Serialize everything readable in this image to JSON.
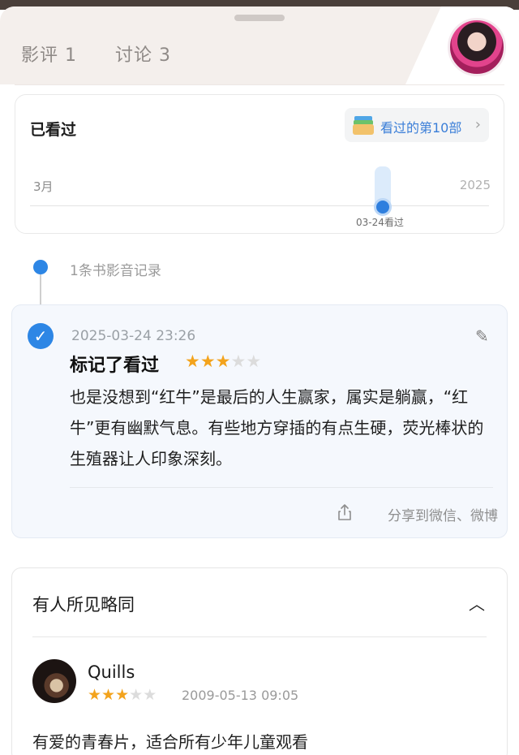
{
  "tabs": [
    {
      "label": "影评 1"
    },
    {
      "label": "讨论 3"
    }
  ],
  "watched": {
    "title": "已看过",
    "badge_label": "看过的第10部",
    "timeline_start": "3月",
    "timeline_end": "2025",
    "marker_label": "03-24看过"
  },
  "records": {
    "count_label": "1条书影音记录"
  },
  "record": {
    "timestamp": "2025-03-24 23:26",
    "title": "标记了看过",
    "rating": 3,
    "max_rating": 5,
    "body": "也是没想到“红牛”是最后的人生赢家，属实是躺赢，“红牛”更有幽默气息。有些地方穿插的有点生硬，荧光棒状的生殖器让人印象深刻。",
    "share_label": "分享到微信、微博"
  },
  "similar": {
    "title": "有人所见略同",
    "review": {
      "user": "Quills",
      "rating": 3,
      "max_rating": 5,
      "time": "2009-05-13 09:05",
      "comment": "有爱的青春片，适合所有少年儿童观看"
    }
  },
  "colors": {
    "accent": "#2d86e5",
    "star": "#f3a31c",
    "star_empty": "#dcdcdc"
  },
  "icons": [
    "edit-pencil-icon",
    "check-icon",
    "share-icon",
    "chevron-right-icon",
    "chevron-up-icon"
  ]
}
